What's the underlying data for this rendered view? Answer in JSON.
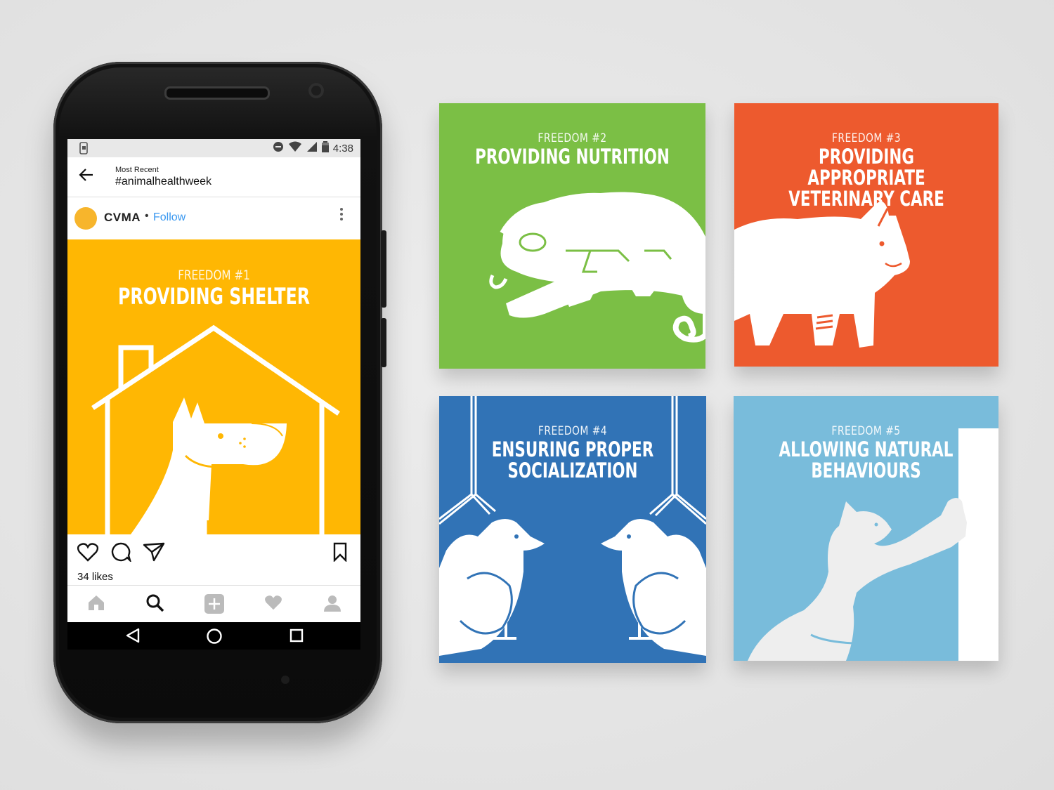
{
  "phone": {
    "status_bar": {
      "time": "4:38"
    },
    "header": {
      "subtitle": "Most Recent",
      "hashtag": "#animalhealthweek"
    },
    "post": {
      "username": "CVMA",
      "separator": "•",
      "follow_label": "Follow",
      "kicker": "FREEDOM #1",
      "title": "PROVIDING SHELTER",
      "likes": "34 likes",
      "colors": {
        "background": "#ffb703"
      }
    }
  },
  "cards": [
    {
      "kicker": "FREEDOM #2",
      "title": "PROVIDING NUTRITION",
      "color": "#7bbf45",
      "illustration": "chameleon-illustration"
    },
    {
      "kicker": "FREEDOM #3",
      "title": "PROVIDING APPROPRIATE\nVETERINARY CARE",
      "color": "#ed5a2e",
      "illustration": "pig-illustration"
    },
    {
      "kicker": "FREEDOM #4",
      "title": "ENSURING PROPER\nSOCIALIZATION",
      "color": "#3173b6",
      "illustration": "parrots-illustration"
    },
    {
      "kicker": "FREEDOM #5",
      "title": "ALLOWING NATURAL\nBEHAVIOURS",
      "color": "#79bcdb",
      "illustration": "cat-illustration"
    }
  ]
}
